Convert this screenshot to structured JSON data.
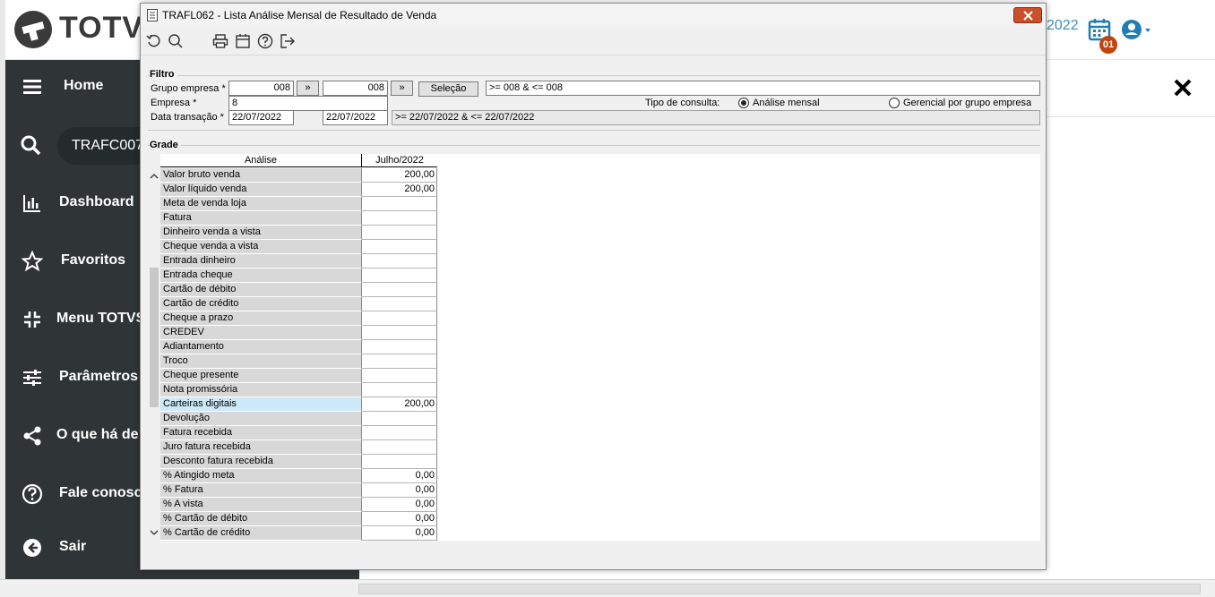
{
  "header": {
    "logo_text": "TOTVS",
    "partial_date": "2022",
    "notification_count": "01"
  },
  "sidebar": {
    "search_value": "TRAFC007",
    "items": [
      {
        "label": "Home",
        "icon": "menu-icon"
      },
      {
        "label": "Dashboard",
        "icon": "chart-icon"
      },
      {
        "label": "Favoritos",
        "icon": "star-icon"
      },
      {
        "label": "Menu TOTVS",
        "icon": "compress-icon"
      },
      {
        "label": "Parâmetros",
        "icon": "sliders-icon"
      },
      {
        "label": "O que há de n",
        "icon": "share-icon"
      },
      {
        "label": "Fale conosco",
        "icon": "help-icon"
      },
      {
        "label": "Sair",
        "icon": "logout-icon"
      }
    ]
  },
  "dialog": {
    "title": "TRAFL062 - Lista Análise Mensal de Resultado de Venda",
    "filter": {
      "group_title": "Filtro",
      "grupo_label": "Grupo empresa *",
      "grupo_from": "008",
      "grupo_to": "008",
      "more_button": "»",
      "selecao_button": "Seleção",
      "grupo_expr": ">= 008 & <= 008",
      "empresa_label": "Empresa *",
      "empresa_value": "8",
      "data_label": "Data transação *",
      "data_from": "22/07/2022",
      "data_to": "22/07/2022",
      "data_expr": ">= 22/07/2022 & <= 22/07/2022",
      "tipo_label": "Tipo de consulta:",
      "option_mensal": "Análise mensal",
      "option_gerencial": "Gerencial por grupo empresa"
    },
    "grade": {
      "group_title": "Grade",
      "col_analise": "Análise",
      "col_month": "Julho/2022",
      "rows": [
        {
          "label": "Valor bruto venda",
          "value": "200,00"
        },
        {
          "label": "Valor líquido venda",
          "value": "200,00"
        },
        {
          "label": "Meta de venda loja",
          "value": ""
        },
        {
          "label": "Fatura",
          "value": ""
        },
        {
          "label": "Dinheiro venda a vista",
          "value": ""
        },
        {
          "label": "Cheque venda a vista",
          "value": ""
        },
        {
          "label": "Entrada dinheiro",
          "value": ""
        },
        {
          "label": "Entrada cheque",
          "value": ""
        },
        {
          "label": "Cartão de débito",
          "value": ""
        },
        {
          "label": "Cartão de crédito",
          "value": ""
        },
        {
          "label": "Cheque a prazo",
          "value": ""
        },
        {
          "label": "CREDEV",
          "value": ""
        },
        {
          "label": "Adiantamento",
          "value": ""
        },
        {
          "label": "Troco",
          "value": ""
        },
        {
          "label": "Cheque presente",
          "value": ""
        },
        {
          "label": "Nota promissória",
          "value": ""
        },
        {
          "label": "Carteiras digitais",
          "value": "200,00"
        },
        {
          "label": "Devolução",
          "value": ""
        },
        {
          "label": "Fatura recebida",
          "value": ""
        },
        {
          "label": "Juro fatura recebida",
          "value": ""
        },
        {
          "label": "Desconto fatura recebida",
          "value": ""
        },
        {
          "label": "% Atingido meta",
          "value": "0,00"
        },
        {
          "label": "% Fatura",
          "value": "0,00"
        },
        {
          "label": "% A vista",
          "value": "0,00"
        },
        {
          "label": "% Cartão de débito",
          "value": "0,00"
        },
        {
          "label": "% Cartão de crédito",
          "value": "0,00"
        }
      ]
    }
  },
  "colors": {
    "sidebar_bg": "#2f3437",
    "accent_blue": "#3a8fb7",
    "badge": "#c1440e",
    "dialog_bg": "#f0f0f0",
    "selected_row": "#cde8f6"
  }
}
